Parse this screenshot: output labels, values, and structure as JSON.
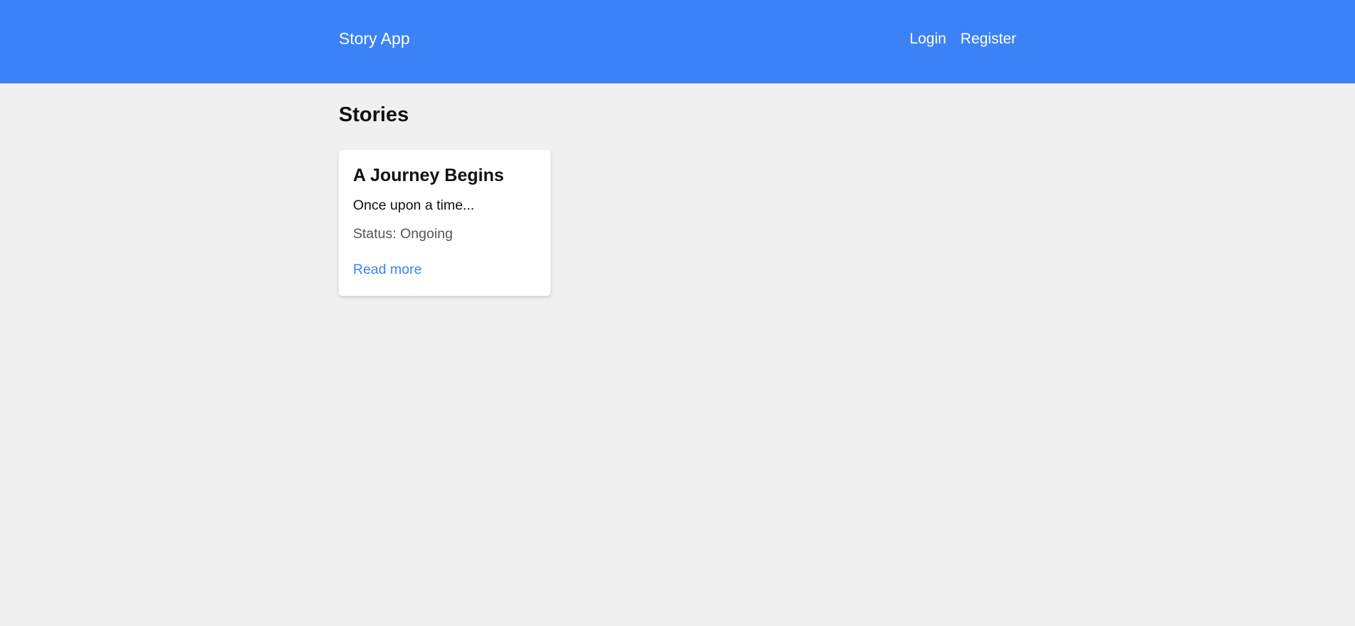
{
  "header": {
    "brand": "Story App",
    "nav": {
      "login_label": "Login",
      "register_label": "Register"
    }
  },
  "main": {
    "title": "Stories",
    "stories": [
      {
        "title": "A Journey Begins",
        "excerpt": "Once upon a time...",
        "status": "Status: Ongoing",
        "link_label": "Read more"
      }
    ]
  },
  "colors": {
    "header_bg": "#3b82f6",
    "page_bg": "#f0f0f0",
    "link": "#3b82f6"
  }
}
